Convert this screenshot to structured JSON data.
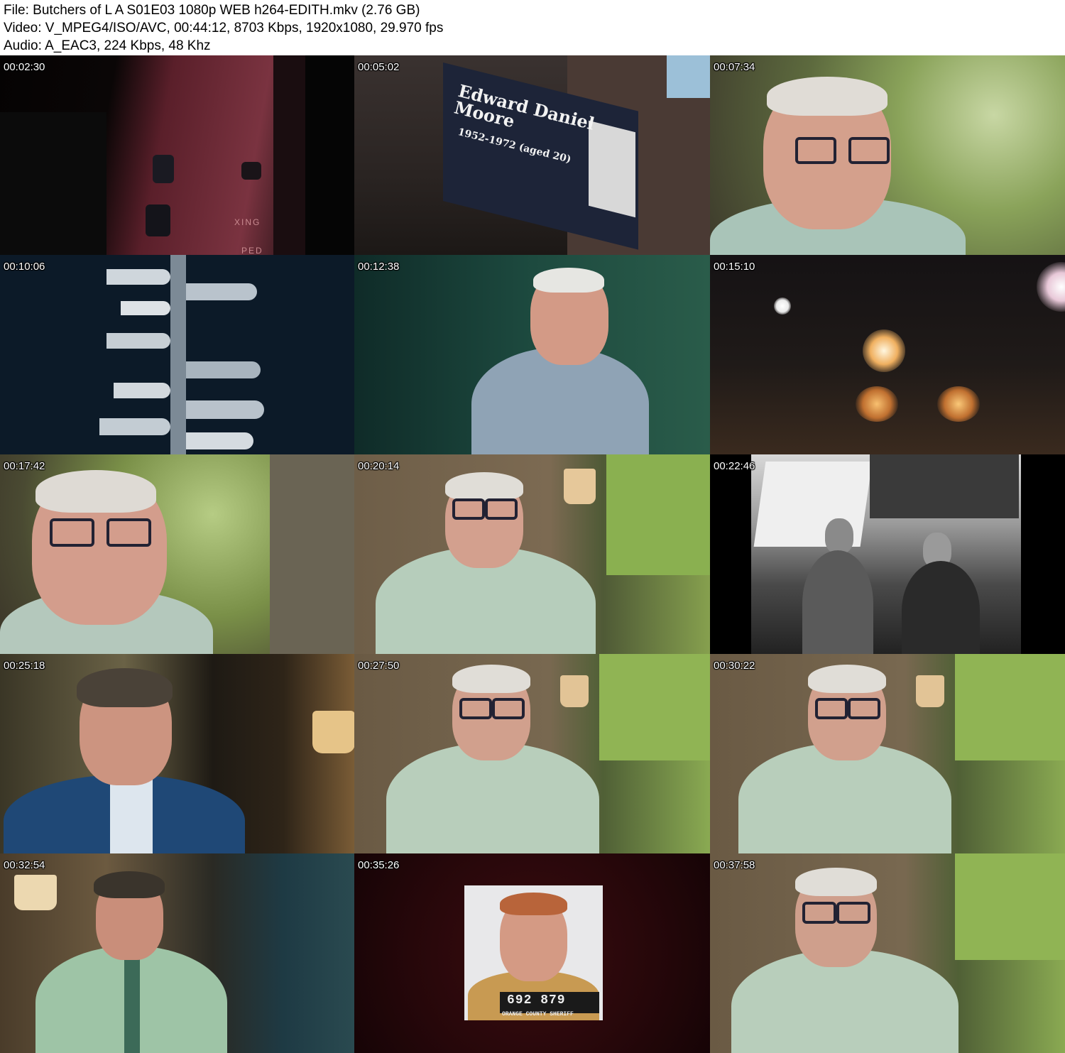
{
  "header": {
    "file_line": "File: Butchers of L A S01E03 1080p WEB h264-EDITH.mkv (2.76 GB)",
    "video_line": "Video: V_MPEG4/ISO/AVC, 00:44:12, 8703 Kbps, 1920x1080, 29.970 fps",
    "audio_line": "Audio: A_EAC3, 224 Kbps, 48 Khz"
  },
  "thumbnails": [
    {
      "time": "00:02:30"
    },
    {
      "time": "00:05:02",
      "billboard_name": "Edward Daniel Moore",
      "billboard_name_1": "Edward Daniel",
      "billboard_name_2": "Moore",
      "billboard_years": "1952-1972 (aged 20)"
    },
    {
      "time": "00:07:34"
    },
    {
      "time": "00:10:06"
    },
    {
      "time": "00:12:38"
    },
    {
      "time": "00:15:10"
    },
    {
      "time": "00:17:42"
    },
    {
      "time": "00:20:14"
    },
    {
      "time": "00:22:46"
    },
    {
      "time": "00:25:18"
    },
    {
      "time": "00:27:50"
    },
    {
      "time": "00:30:22"
    },
    {
      "time": "00:32:54"
    },
    {
      "time": "00:35:26",
      "mug_number": "692 879",
      "mug_caption": "ORANGE COUNTY SHERIFF"
    },
    {
      "time": "00:37:58"
    }
  ]
}
